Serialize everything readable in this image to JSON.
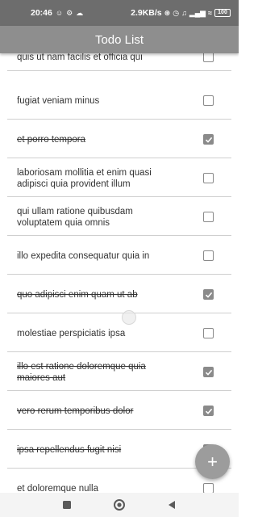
{
  "status_bar": {
    "time": "20:46",
    "left_icons": [
      "notification-icon",
      "vpn-key-icon",
      "cloud-icon"
    ],
    "network_speed": "2.9KB/s",
    "right_icons": [
      "bluetooth-icon",
      "alarm-icon",
      "volume-icon",
      "signal-icon",
      "signal-icon",
      "wifi-icon"
    ],
    "battery": "100"
  },
  "app_bar": {
    "title": "Todo List"
  },
  "todos": [
    {
      "text": "quis ut nam facilis et officia qui",
      "completed": false
    },
    {
      "text": "fugiat veniam minus",
      "completed": false
    },
    {
      "text": "et porro tempora",
      "completed": true
    },
    {
      "text": "laboriosam mollitia et enim quasi adipisci quia provident illum",
      "completed": false
    },
    {
      "text": "qui ullam ratione quibusdam voluptatem quia omnis",
      "completed": false
    },
    {
      "text": "illo expedita consequatur quia in",
      "completed": false
    },
    {
      "text": "quo adipisci enim quam ut ab",
      "completed": true
    },
    {
      "text": "molestiae perspiciatis ipsa",
      "completed": false
    },
    {
      "text": "illo est ratione doloremque quia maiores aut",
      "completed": true
    },
    {
      "text": "vero rerum temporibus dolor",
      "completed": true
    },
    {
      "text": "ipsa repellendus fugit nisi",
      "completed": true
    },
    {
      "text": "et doloremque nulla",
      "completed": false
    }
  ],
  "fab": {
    "label": "+",
    "icon": "add-icon"
  },
  "nav_bar": {
    "icons": [
      "recent-apps-icon",
      "home-icon",
      "back-icon"
    ]
  },
  "colors": {
    "app_bar": "#8e8e8e",
    "status_bar": "#6d6d6d",
    "fab": "#9c9c9c",
    "checkbox": "#8a8a8a"
  }
}
